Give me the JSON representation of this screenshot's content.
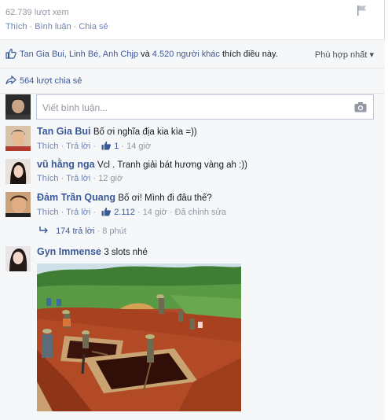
{
  "post": {
    "views": "62.739 lượt xem",
    "actions": [
      "Thích",
      "Bình luận",
      "Chia sẻ"
    ]
  },
  "likes": {
    "names": "Tan Gia Bui, Linh Bé, Anh Chjp",
    "and": "và",
    "others": "4.520 người khác",
    "suffix": "thích điều này."
  },
  "sort_label": "Phù hợp nhất ▾",
  "shares": "564 lượt chia sẻ",
  "composer": {
    "placeholder": "Viết bình luận..."
  },
  "comments": [
    {
      "name": "Tan Gia Bui",
      "text": "Bố ơi nghĩa địa kia kìa =))",
      "like": "Thích",
      "reply": "Trả lời",
      "likes": "1",
      "time": "14 giờ"
    },
    {
      "name": "vũ hằng nga",
      "text": "Vcl . Tranh giải bát hương vàng ah :))",
      "like": "Thích",
      "reply": "Trả lời",
      "time": "12 giờ"
    },
    {
      "name": "Đảm Trần Quang",
      "text": "Bố ơi! Mình đi đâu thế?",
      "like": "Thích",
      "reply": "Trả lời",
      "likes": "2.112",
      "time": "14 giờ",
      "edited": "Đã chỉnh sửa"
    },
    {
      "name": "Gyn Immense",
      "text": "3 slots nhé"
    }
  ],
  "replies": {
    "count": "174 trả lời",
    "time": "8 phút"
  },
  "colors": {
    "link": "#3b5998",
    "meta": "#9197a3",
    "bg": "#f6f7f9"
  }
}
